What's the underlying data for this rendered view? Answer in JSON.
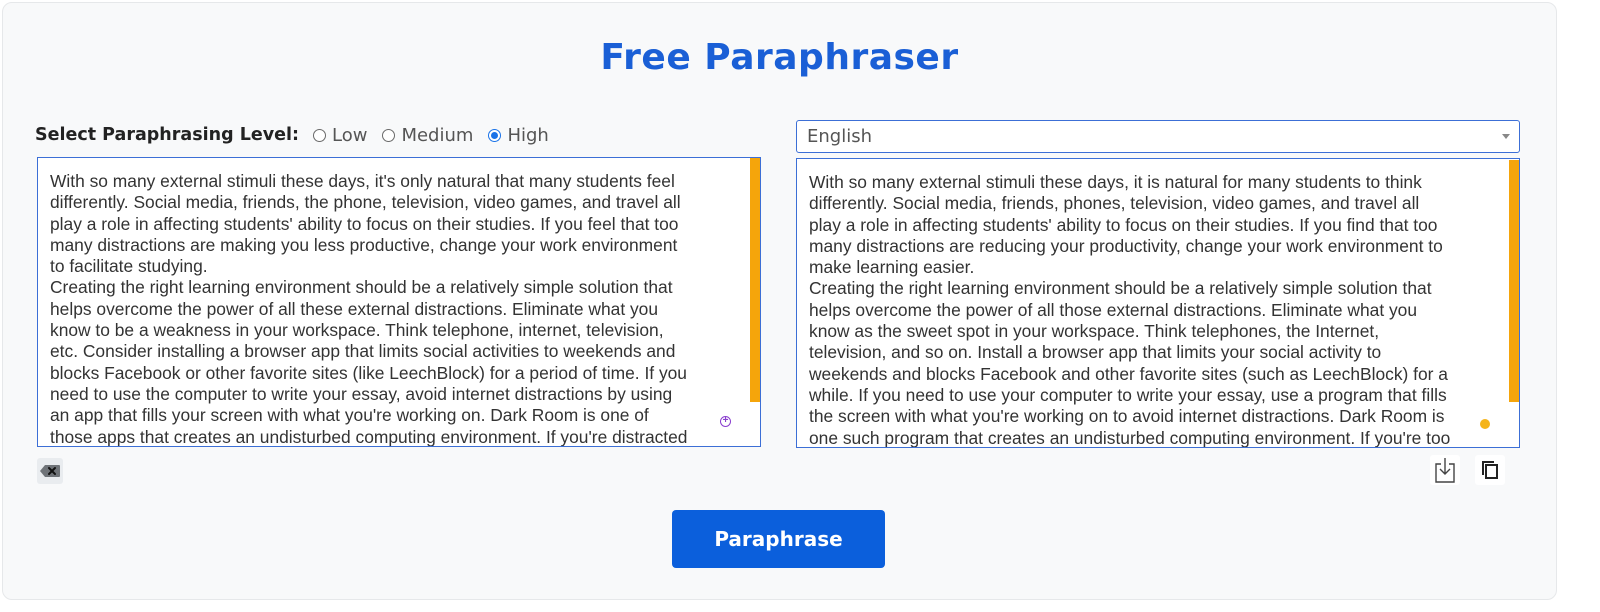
{
  "title": "Free Paraphraser",
  "level": {
    "label": "Select Paraphrasing Level:",
    "options": [
      "Low",
      "Medium",
      "High"
    ],
    "selected": "High"
  },
  "language": {
    "selected": "English"
  },
  "input_text": "With so many external stimuli these days, it's only natural that many students feel\ndifferently. Social media, friends, the phone, television, video games, and travel all\nplay a role in affecting students' ability to focus on their studies. If you feel that too\nmany distractions are making you less productive, change your work environment\nto facilitate studying.\nCreating the right learning environment should be a relatively simple solution that\nhelps overcome the power of all these external distractions. Eliminate what you\nknow to be a weakness in your workspace. Think telephone, internet, television,\netc. Consider installing a browser app that limits social activities to weekends and\nblocks Facebook or other favorite sites (like LeechBlock) for a period of time. If you\nneed to use the computer to write your essay, avoid internet distractions by using\nan app that fills your screen with what you're working on. Dark Room is one of\nthose apps that creates an undisturbed computing environment. If you're distracted",
  "output_text": "With so many external stimuli these days, it is natural for many students to think\ndifferently. Social media, friends, phones, television, video games, and travel all\nplay a role in affecting students' ability to focus on their studies. If you find that too\nmany distractions are reducing your productivity, change your work environment to\nmake learning easier.\nCreating the right learning environment should be a relatively simple solution that\nhelps overcome the power of all those external distractions. Eliminate what you\nknow as the sweet spot in your workspace. Think telephones, the Internet,\ntelevision, and so on. Install a browser app that limits your social activity to\nweekends and blocks Facebook and other favorite sites (such as LeechBlock) for a\nwhile. If you need to use your computer to write your essay, use a program that fills\nthe screen with what you're working on to avoid internet distractions. Dark Room is\none such program that creates an undisturbed computing environment. If you're too",
  "buttons": {
    "paraphrase": "Paraphrase"
  },
  "icons": {
    "clear": "clear-icon",
    "download": "download-icon",
    "copy": "copy-icon"
  },
  "colors": {
    "accent": "#1a5fd6",
    "button": "#0b5fdc",
    "scrollbar": "#f5a50b"
  }
}
